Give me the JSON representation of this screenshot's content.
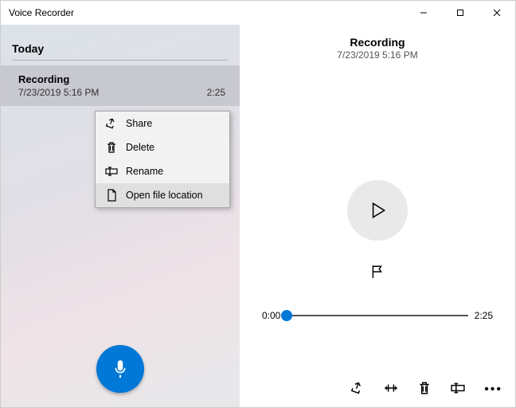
{
  "app_title": "Voice Recorder",
  "left": {
    "section_header": "Today",
    "recording": {
      "title": "Recording",
      "datetime": "7/23/2019 5:16 PM",
      "duration": "2:25"
    }
  },
  "context_menu": {
    "share": "Share",
    "delete": "Delete",
    "rename": "Rename",
    "open_location": "Open file location"
  },
  "right": {
    "title": "Recording",
    "datetime": "7/23/2019 5:16 PM",
    "time_start": "0:00",
    "time_end": "2:25"
  },
  "colors": {
    "accent": "#0078d7"
  }
}
